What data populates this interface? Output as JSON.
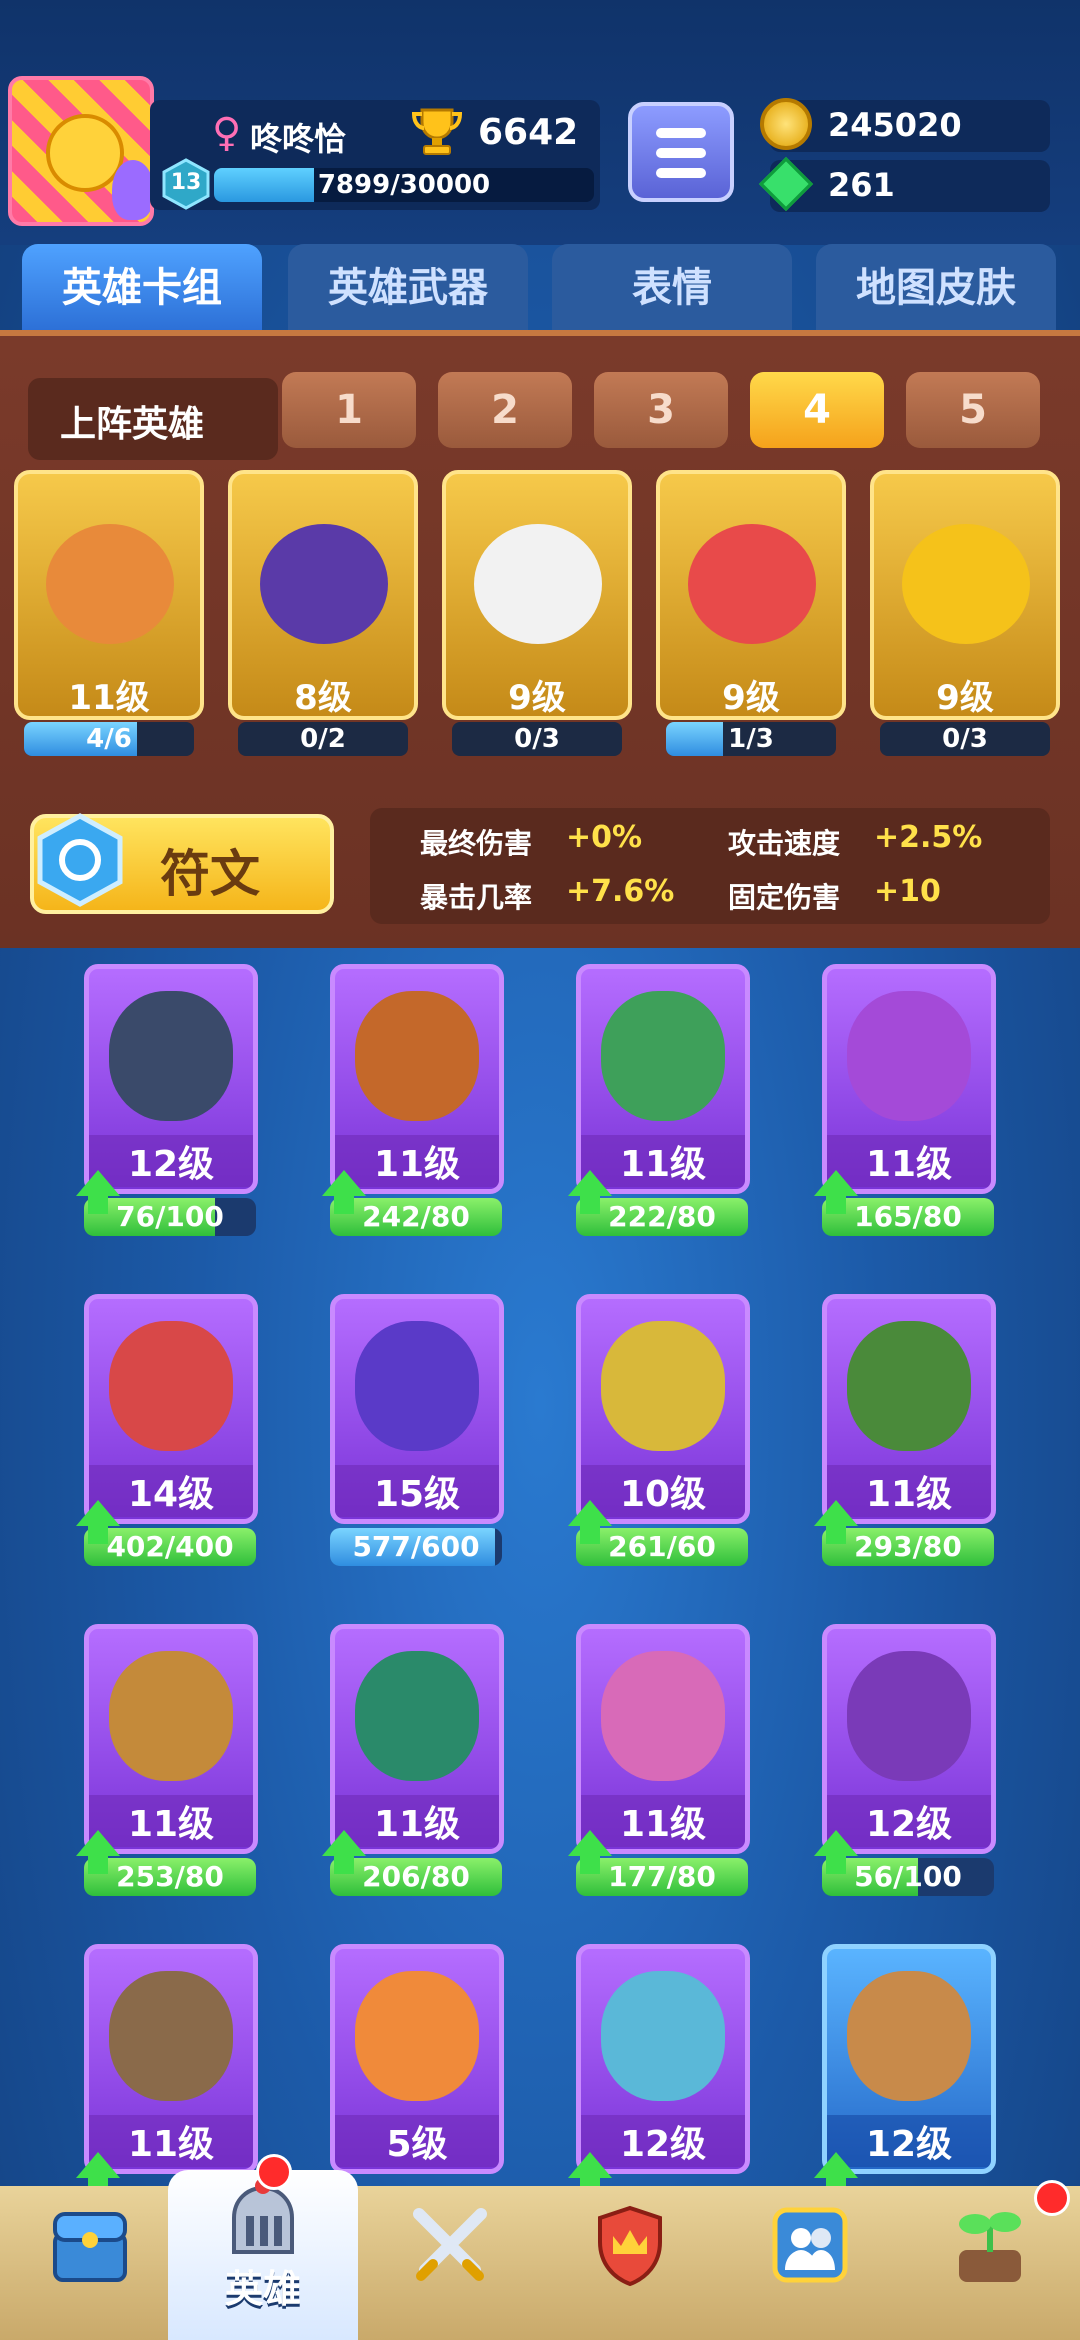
{
  "header": {
    "player_name": "咚咚恰",
    "trophies": "6642",
    "level": "13",
    "xp_text": "7899/30000",
    "xp_fraction": 0.263,
    "coins": "245020",
    "gems": "261"
  },
  "tabs": [
    {
      "label": "英雄卡组",
      "active": true
    },
    {
      "label": "英雄武器",
      "active": false
    },
    {
      "label": "表情",
      "active": false
    },
    {
      "label": "地图皮肤",
      "active": false
    }
  ],
  "team": {
    "label": "上阵英雄",
    "slots": [
      "1",
      "2",
      "3",
      "4",
      "5"
    ],
    "active_slot": "4"
  },
  "lineup": [
    {
      "level": "11级",
      "progress_text": "4/6",
      "progress": 0.667,
      "color": "#e88a3a"
    },
    {
      "level": "8级",
      "progress_text": "0/2",
      "progress": 0,
      "color": "#5a3aa8"
    },
    {
      "level": "9级",
      "progress_text": "0/3",
      "progress": 0,
      "color": "#f2f2f2"
    },
    {
      "level": "9级",
      "progress_text": "1/3",
      "progress": 0.333,
      "color": "#e84a4a"
    },
    {
      "level": "9级",
      "progress_text": "0/3",
      "progress": 0,
      "color": "#f5c21a"
    }
  ],
  "rune": {
    "label": "符文"
  },
  "stats": [
    {
      "name": "最终伤害",
      "value": "+0%"
    },
    {
      "name": "攻击速度",
      "value": "+2.5%"
    },
    {
      "name": "暴击几率",
      "value": "+7.6%"
    },
    {
      "name": "固定伤害",
      "value": "+10"
    }
  ],
  "heroes": [
    {
      "level": "12级",
      "progress_text": "76/100",
      "progress": 0.76,
      "color": "#3a4a6a",
      "can_upgrade": true,
      "blue": false
    },
    {
      "level": "11级",
      "progress_text": "242/80",
      "progress": 1,
      "color": "#c4682a",
      "can_upgrade": true,
      "blue": false
    },
    {
      "level": "11级",
      "progress_text": "222/80",
      "progress": 1,
      "color": "#3ea05a",
      "can_upgrade": true,
      "blue": false
    },
    {
      "level": "11级",
      "progress_text": "165/80",
      "progress": 1,
      "color": "#a44ad8",
      "can_upgrade": true,
      "blue": false
    },
    {
      "level": "14级",
      "progress_text": "402/400",
      "progress": 1,
      "color": "#d84848",
      "can_upgrade": true,
      "blue": false
    },
    {
      "level": "15级",
      "progress_text": "577/600",
      "progress": 0.96,
      "color": "#5a3ac8",
      "can_upgrade": false,
      "blue": false
    },
    {
      "level": "10级",
      "progress_text": "261/60",
      "progress": 1,
      "color": "#d8b83a",
      "can_upgrade": true,
      "blue": false
    },
    {
      "level": "11级",
      "progress_text": "293/80",
      "progress": 1,
      "color": "#4a8a3a",
      "can_upgrade": true,
      "blue": false
    },
    {
      "level": "11级",
      "progress_text": "253/80",
      "progress": 1,
      "color": "#c48a3a",
      "can_upgrade": true,
      "blue": false
    },
    {
      "level": "11级",
      "progress_text": "206/80",
      "progress": 1,
      "color": "#2a8a6a",
      "can_upgrade": true,
      "blue": false
    },
    {
      "level": "11级",
      "progress_text": "177/80",
      "progress": 1,
      "color": "#d86ab8",
      "can_upgrade": true,
      "blue": false
    },
    {
      "level": "12级",
      "progress_text": "56/100",
      "progress": 0.56,
      "color": "#7a3ab8",
      "can_upgrade": true,
      "blue": false
    },
    {
      "level": "11级",
      "progress_text": "",
      "progress": 0,
      "color": "#8a6a4a",
      "can_upgrade": true,
      "blue": false
    },
    {
      "level": "5级",
      "progress_text": "",
      "progress": 0,
      "color": "#f08a3a",
      "can_upgrade": false,
      "blue": false
    },
    {
      "level": "12级",
      "progress_text": "",
      "progress": 0,
      "color": "#5ab8d8",
      "can_upgrade": true,
      "blue": false
    },
    {
      "level": "12级",
      "progress_text": "",
      "progress": 0,
      "color": "#c88a4a",
      "can_upgrade": true,
      "blue": true
    }
  ],
  "nav": [
    {
      "label": "",
      "icon": "treasure-chest-icon",
      "active": false
    },
    {
      "label": "英雄",
      "icon": "knight-helmet-icon",
      "active": true
    },
    {
      "label": "",
      "icon": "crossed-swords-icon",
      "active": false
    },
    {
      "label": "",
      "icon": "shield-crown-icon",
      "active": false
    },
    {
      "label": "",
      "icon": "friends-icon",
      "active": false
    },
    {
      "label": "",
      "icon": "sprout-icon",
      "active": false
    }
  ]
}
